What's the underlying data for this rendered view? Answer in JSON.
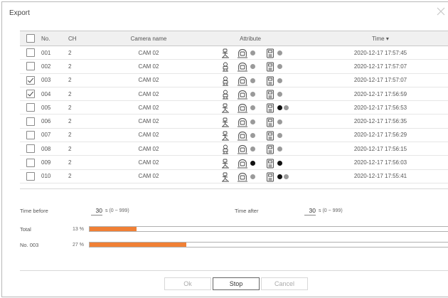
{
  "dialog": {
    "title": "Export"
  },
  "table": {
    "headers": {
      "no": "No.",
      "ch": "CH",
      "camera": "Camera name",
      "attribute": "Attribute",
      "time": "Time ▾"
    },
    "rows": [
      {
        "no": "001",
        "ch": "2",
        "camera": "CAM 02",
        "checked": false,
        "time": "2020-12-17 17:57:45",
        "person": "walk",
        "face_dot": true,
        "car_dots": [
          "grey"
        ]
      },
      {
        "no": "002",
        "ch": "2",
        "camera": "CAM 02",
        "checked": false,
        "time": "2020-12-17 17:57:07",
        "person": "stand",
        "face_dot": true,
        "car_dots": [
          "grey"
        ]
      },
      {
        "no": "003",
        "ch": "2",
        "camera": "CAM 02",
        "checked": true,
        "time": "2020-12-17 17:57:07",
        "person": "stand",
        "face_dot": true,
        "car_dots": [
          "grey"
        ]
      },
      {
        "no": "004",
        "ch": "2",
        "camera": "CAM 02",
        "checked": true,
        "time": "2020-12-17 17:56:59",
        "person": "stand",
        "face_dot": true,
        "car_dots": [
          "grey"
        ]
      },
      {
        "no": "005",
        "ch": "2",
        "camera": "CAM 02",
        "checked": false,
        "time": "2020-12-17 17:56:53",
        "person": "walk",
        "face_dot": true,
        "car_dots": [
          "black",
          "grey"
        ]
      },
      {
        "no": "006",
        "ch": "2",
        "camera": "CAM 02",
        "checked": false,
        "time": "2020-12-17 17:56:35",
        "person": "walk",
        "face_dot": true,
        "car_dots": [
          "grey"
        ]
      },
      {
        "no": "007",
        "ch": "2",
        "camera": "CAM 02",
        "checked": false,
        "time": "2020-12-17 17:56:29",
        "person": "walk",
        "face_dot": true,
        "car_dots": [
          "grey"
        ]
      },
      {
        "no": "008",
        "ch": "2",
        "camera": "CAM 02",
        "checked": false,
        "time": "2020-12-17 17:56:15",
        "person": "stand",
        "face_dot": true,
        "car_dots": [
          "grey"
        ]
      },
      {
        "no": "009",
        "ch": "2",
        "camera": "CAM 02",
        "checked": false,
        "time": "2020-12-17 17:56:03",
        "person": "walk",
        "face_dot": "black",
        "car_dots": [
          "black"
        ]
      },
      {
        "no": "010",
        "ch": "2",
        "camera": "CAM 02",
        "checked": false,
        "time": "2020-12-17 17:55:41",
        "person": "walk",
        "face_dot": true,
        "car_dots": [
          "black",
          "grey"
        ]
      }
    ]
  },
  "settings": {
    "time_before_label": "Time before",
    "time_before_value": "30",
    "time_before_range": "s (0 ~ 999)",
    "time_after_label": "Time after",
    "time_after_value": "30",
    "time_after_range": "s (0 ~ 999)"
  },
  "progress": {
    "total_label": "Total",
    "total_percent_text": "13 %",
    "total_fraction": 0.13,
    "item_label": "No. 003",
    "item_percent_text": "27 %",
    "item_fraction": 0.27
  },
  "buttons": {
    "ok": "Ok",
    "stop": "Stop",
    "cancel": "Cancel"
  },
  "colors": {
    "progress": "#f08035",
    "dot_grey": "#9a9a9a",
    "dot_black": "#111111"
  }
}
